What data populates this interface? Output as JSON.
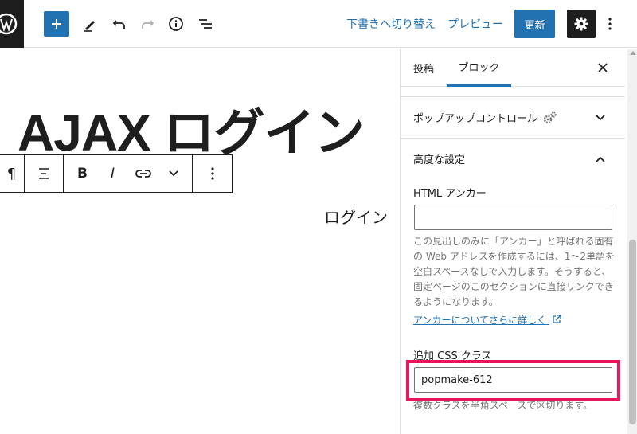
{
  "toolbar": {
    "switch_to_draft": "下書きへ切り替え",
    "preview": "プレビュー",
    "update": "更新"
  },
  "editor": {
    "heading": "AJAX ログイン",
    "paragraph": "ログイン",
    "block_toolbar": {
      "paragraph_symbol": "¶",
      "bold": "B",
      "italic": "I"
    }
  },
  "sidebar": {
    "tabs": [
      "投稿",
      "ブロック"
    ],
    "active_tab": "ブロック",
    "popup_panel_title": "ポップアップコントロール",
    "advanced_panel_title": "高度な設定",
    "html_anchor_label": "HTML アンカー",
    "html_anchor_value": "",
    "html_anchor_help": "この見出しのみに「アンカー」と呼ばれる固有の Web アドレスを作成するには、1〜2単語を空白スペースなしで入力します。そうすると、固定ページのこのセクションに直接リンクできるようになります。",
    "anchor_link": "アンカーについてさらに詳しく",
    "css_class_label": "追加 CSS クラス",
    "css_class_value": "popmake-612",
    "css_class_help": "複数クラスを半角スペースで区切ります。"
  },
  "colors": {
    "accent": "#2271b1",
    "highlight": "#e6155e",
    "dark": "#1e1e1e"
  }
}
